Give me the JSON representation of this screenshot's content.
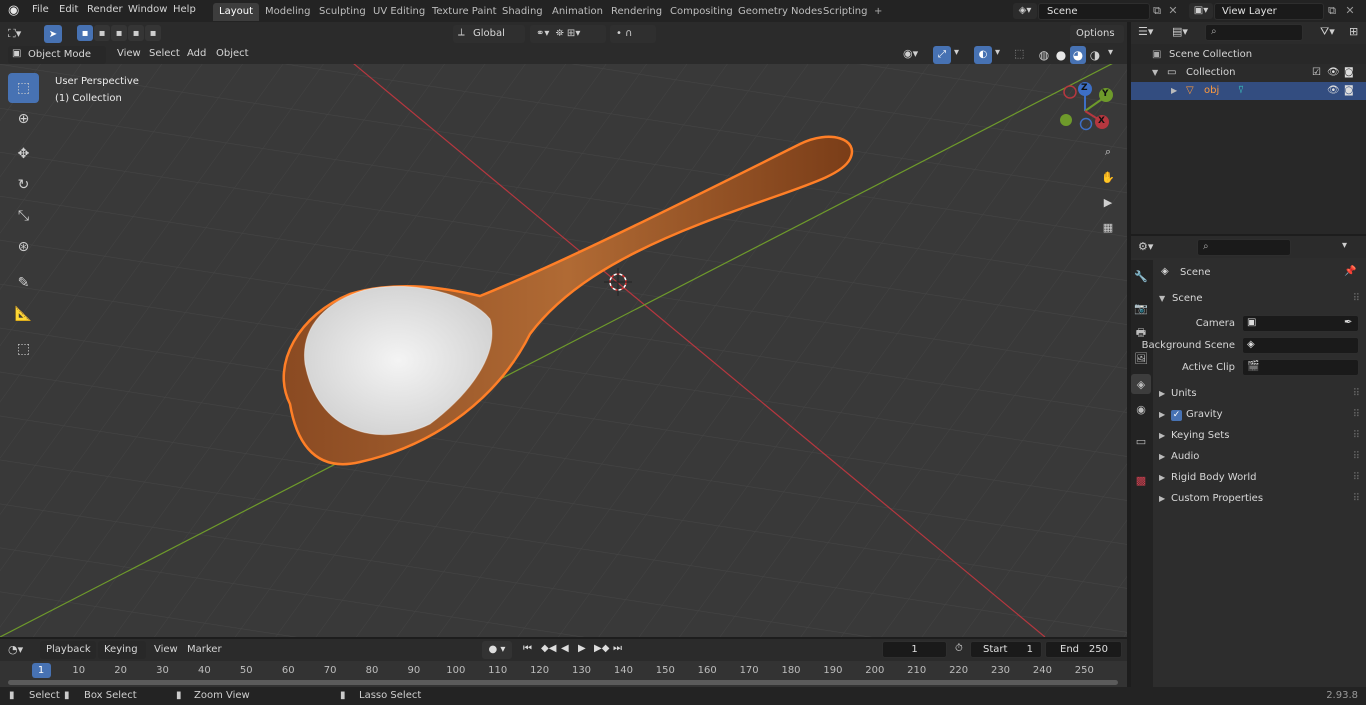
{
  "topbar": {
    "menus": [
      "File",
      "Edit",
      "Render",
      "Window",
      "Help"
    ],
    "workspaces": [
      "Layout",
      "Modeling",
      "Sculpting",
      "UV Editing",
      "Texture Paint",
      "Shading",
      "Animation",
      "Rendering",
      "Compositing",
      "Geometry Nodes",
      "Scripting"
    ],
    "active_workspace": "Layout",
    "add_tab_label": "+",
    "scene_name": "Scene",
    "view_layer": "View Layer"
  },
  "viewport_header": {
    "mode": "Object Mode",
    "menus": [
      "View",
      "Select",
      "Add",
      "Object"
    ],
    "transform_orientation": "Global",
    "options_label": "Options"
  },
  "viewport": {
    "perspective_label": "User Perspective",
    "collection_label": "(1) Collection",
    "gizmo_axes": {
      "z": "Z",
      "y": "Y",
      "x": "X"
    },
    "colors": {
      "x_axis": "#b5373f",
      "y_axis": "#6e9a2b",
      "selection": "#ff7f27",
      "grid_bg": "#3a3a3a"
    }
  },
  "outliner": {
    "search_placeholder": "",
    "scene_collection": "Scene Collection",
    "collection": "Collection",
    "object": "obj"
  },
  "properties": {
    "scene_title": "Scene",
    "section": "Scene",
    "camera_label": "Camera",
    "background_scene_label": "Background Scene",
    "active_clip_label": "Active Clip",
    "panels": [
      "Units",
      "Gravity",
      "Keying Sets",
      "Audio",
      "Rigid Body World",
      "Custom Properties"
    ],
    "gravity_checked": true
  },
  "timeline": {
    "menus": [
      "Playback",
      "Keying",
      "View",
      "Marker"
    ],
    "current_frame": "1",
    "start_label": "Start",
    "start": "1",
    "end_label": "End",
    "end": "250",
    "ticks": [
      "1",
      "10",
      "20",
      "30",
      "40",
      "50",
      "60",
      "70",
      "80",
      "90",
      "100",
      "110",
      "120",
      "130",
      "140",
      "150",
      "160",
      "170",
      "180",
      "190",
      "200",
      "210",
      "220",
      "230",
      "240",
      "250"
    ]
  },
  "statusbar": {
    "select": "Select",
    "box_select": "Box Select",
    "zoom_view": "Zoom View",
    "lasso_select": "Lasso Select",
    "version": "2.93.8"
  }
}
